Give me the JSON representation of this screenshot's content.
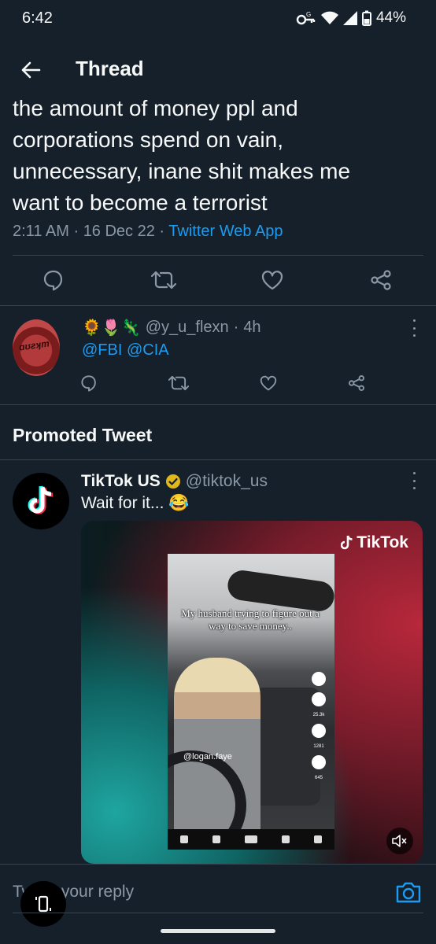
{
  "status_bar": {
    "time": "6:42",
    "battery": "44%"
  },
  "header": {
    "title": "Thread",
    "back_icon": "arrow-left-icon"
  },
  "tweet": {
    "lines": [
      "the amount of money ppl and",
      "corporations spend on vain,",
      "unnecessary, inane shit makes me",
      "want to become a terrorist"
    ],
    "time": "2:11 AM",
    "date": "16 Dec 22",
    "source": "Twitter Web App"
  },
  "reply": {
    "emojis": "🌻🌷🦎",
    "handle": "@y_u_flexn",
    "age": "4h",
    "text": "@FBI @CIA"
  },
  "promoted": {
    "section_title": "Promoted Tweet",
    "name": "TikTok US",
    "handle": "@tiktok_us",
    "text": "Wait for it... 😂",
    "media_brand": "TikTok",
    "video_caption": "My husband trying to figure out a way to save money..",
    "video_username": "@logan.faye",
    "video_counts": [
      "25.3k",
      "1281",
      "645"
    ]
  },
  "composer": {
    "placeholder": "Tweet your reply"
  },
  "colors": {
    "background": "#15202b",
    "accent": "#1d9bf0",
    "muted": "#8b98a5",
    "divider": "#38444d"
  }
}
